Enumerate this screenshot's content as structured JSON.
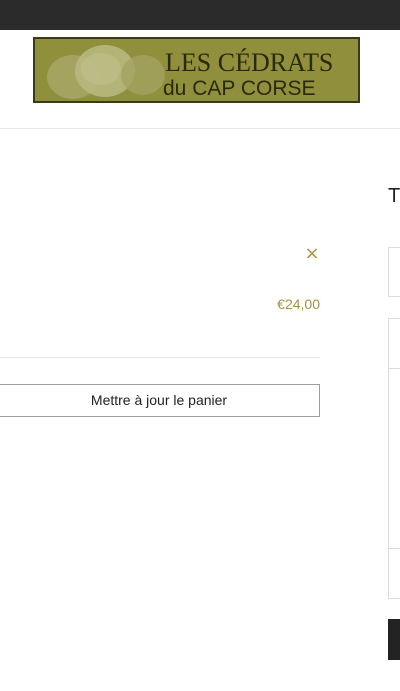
{
  "header": {
    "logo": {
      "line1": "LES CÉDRATS",
      "line2": "du CAP CORSE"
    }
  },
  "cart": {
    "remove_symbol": "×",
    "item_price": "€24,00",
    "update_button_label": "Mettre à jour le panier"
  },
  "totals": {
    "title_visible": "T"
  },
  "colors": {
    "topbar": "#2b2b2b",
    "logo_background": "#8a8a38",
    "accent_price": "#a3903f",
    "checkout_button": "#232323"
  }
}
